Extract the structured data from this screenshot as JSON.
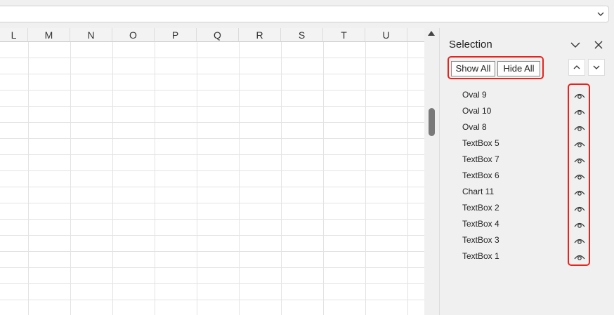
{
  "columns": [
    "L",
    "M",
    "N",
    "O",
    "P",
    "Q",
    "R",
    "S",
    "T",
    "U"
  ],
  "selection_pane": {
    "title": "Selection",
    "show_all_label": "Show All",
    "hide_all_label": "Hide All",
    "items": [
      {
        "label": "Oval 9"
      },
      {
        "label": "Oval 10"
      },
      {
        "label": "Oval 8"
      },
      {
        "label": "TextBox 5"
      },
      {
        "label": "TextBox 7"
      },
      {
        "label": "TextBox 6"
      },
      {
        "label": "Chart 11"
      },
      {
        "label": "TextBox 2"
      },
      {
        "label": "TextBox 4"
      },
      {
        "label": "TextBox 3"
      },
      {
        "label": "TextBox 1"
      }
    ]
  },
  "icons": {
    "formula_expand": "chevron-down-icon",
    "pane_options": "chevron-down-icon",
    "pane_close": "close-icon",
    "bring_forward": "chevron-up-icon",
    "send_backward": "chevron-down-icon",
    "visibility": "eye-icon",
    "scroll_up": "scroll-up-arrow-icon"
  },
  "colors": {
    "highlight": "#e8231d",
    "background": "#f0f0f0"
  }
}
